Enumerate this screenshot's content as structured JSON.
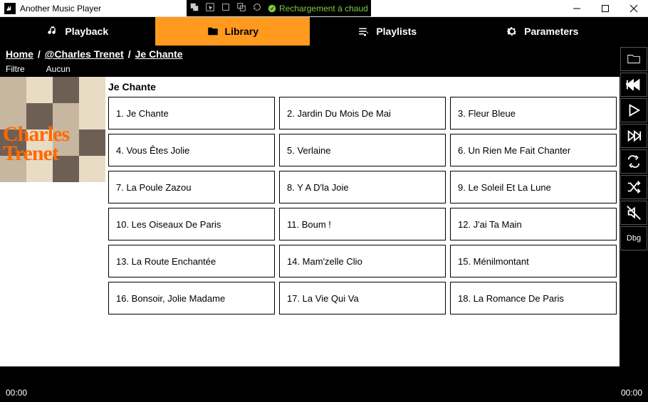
{
  "window": {
    "app_title": "Another Music Player",
    "hot_reload_label": "Rechargement à chaud"
  },
  "tabs": {
    "playback": "Playback",
    "library": "Library",
    "playlists": "Playlists",
    "parameters": "Parameters"
  },
  "sidebar": {
    "dbg_label": "Dbg"
  },
  "breadcrumb": {
    "home": "Home",
    "sep1": "/",
    "artist": "@Charles Trenet",
    "sep2": "/",
    "album": "Je Chante"
  },
  "filter": {
    "label": "Filtre",
    "value": "Aucun"
  },
  "album": {
    "title": "Je Chante",
    "cover_artist_line1": "Charles",
    "cover_artist_line2": "Trenet",
    "tracks": [
      "1. Je Chante",
      "2. Jardin Du Mois De Mai",
      "3. Fleur Bleue",
      "4. Vous Êtes Jolie",
      "5. Verlaine",
      "6. Un Rien Me Fait Chanter",
      "7. La Poule Zazou",
      "8. Y A D'la Joie",
      "9. Le Soleil Et La Lune",
      "10. Les Oiseaux De Paris",
      "11. Boum !",
      "12. J'ai Ta Main",
      "13. La Route Enchantée",
      "14. Mam'zelle Clio",
      "15. Ménilmontant",
      "16. Bonsoir, Jolie Madame",
      "17. La Vie Qui Va",
      "18. La Romance De Paris"
    ]
  },
  "player": {
    "position": "00:00",
    "duration": "00:00"
  },
  "colors": {
    "accent": "#ff9a1f"
  }
}
